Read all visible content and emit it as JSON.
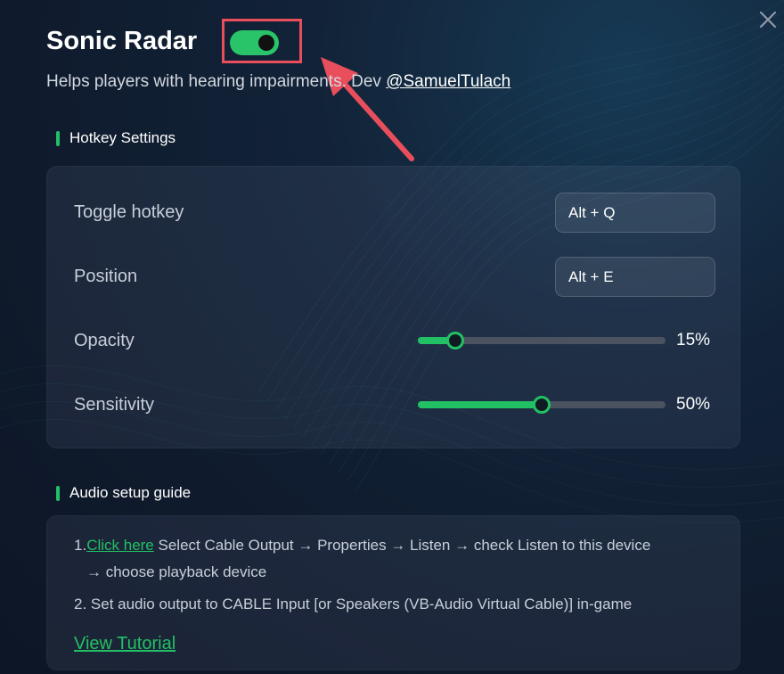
{
  "app": {
    "title": "Sonic Radar",
    "enabled": true,
    "subtitle_text": "Helps players with hearing impairments. Dev ",
    "dev_link": "@SamuelTulach"
  },
  "icons": {
    "close": "close-icon",
    "annotation_arrow": "arrow-icon"
  },
  "colors": {
    "accent": "#22c064",
    "annotation": "#e84e5c",
    "background": "#101b2d"
  },
  "hotkey_settings": {
    "heading": "Hotkey Settings",
    "rows": [
      {
        "label": "Toggle hotkey",
        "value": "Alt + Q"
      },
      {
        "label": "Position",
        "value": "Alt + E"
      }
    ],
    "sliders": [
      {
        "label": "Opacity",
        "value": 15,
        "value_text": "15%"
      },
      {
        "label": "Sensitivity",
        "value": 50,
        "value_text": "50%"
      }
    ]
  },
  "audio_guide": {
    "heading": "Audio setup guide",
    "step1_prefix": "1.",
    "step1_link": "Click here",
    "step1_text": " Select Cable Output → Properties → Listen → check Listen to this device",
    "step1_cont": "→ choose playback device",
    "step2": "2. Set audio output to CABLE Input [or Speakers (VB-Audio Virtual Cable)] in-game",
    "tutorial_link": "View Tutorial"
  }
}
